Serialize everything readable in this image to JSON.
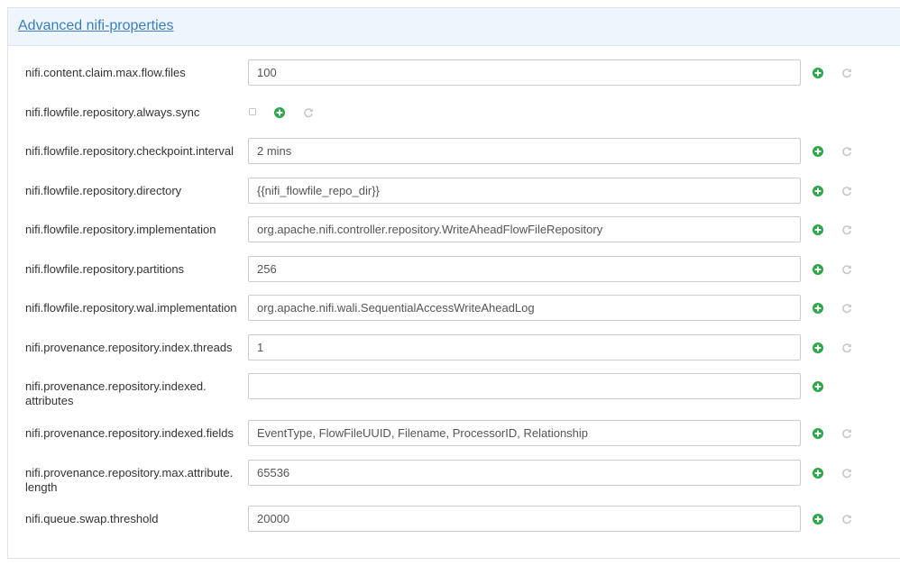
{
  "section": {
    "title": "Advanced nifi-properties"
  },
  "colors": {
    "add_icon": "#2ea64a",
    "undo_icon": "#c8c8c8",
    "heading_bg": "#eef5fc",
    "title_link": "#3a7ec0"
  },
  "icons": {
    "add": "plus-circle-icon",
    "undo": "undo-icon"
  },
  "properties": [
    {
      "label": "nifi.content.claim.max.flow.files",
      "value": "100"
    },
    {
      "label": "nifi.flowfile.repository.always.sync",
      "type": "checkbox",
      "checked": false
    },
    {
      "label": "nifi.flowfile.repository.checkpoint.interval",
      "value": "2 mins"
    },
    {
      "label": "nifi.flowfile.repository.directory",
      "value": "{{nifi_flowfile_repo_dir}}"
    },
    {
      "label": "nifi.flowfile.repository.implementation",
      "value": "org.apache.nifi.controller.repository.WriteAheadFlowFileRepository"
    },
    {
      "label": "nifi.flowfile.repository.partitions",
      "value": "256"
    },
    {
      "label": "nifi.flowfile.repository.wal.implementation",
      "value": "org.apache.nifi.wali.SequentialAccessWriteAheadLog"
    },
    {
      "label": "nifi.provenance.repository.index.threads",
      "value": "1"
    },
    {
      "label": "nifi.provenance.repository.indexed.\nattributes",
      "value": ""
    },
    {
      "label": "nifi.provenance.repository.indexed.fields",
      "value": "EventType, FlowFileUUID, Filename, ProcessorID, Relationship"
    },
    {
      "label": "nifi.provenance.repository.max.attribute.\nlength",
      "value": "65536"
    },
    {
      "label": "nifi.queue.swap.threshold",
      "value": "20000"
    }
  ]
}
